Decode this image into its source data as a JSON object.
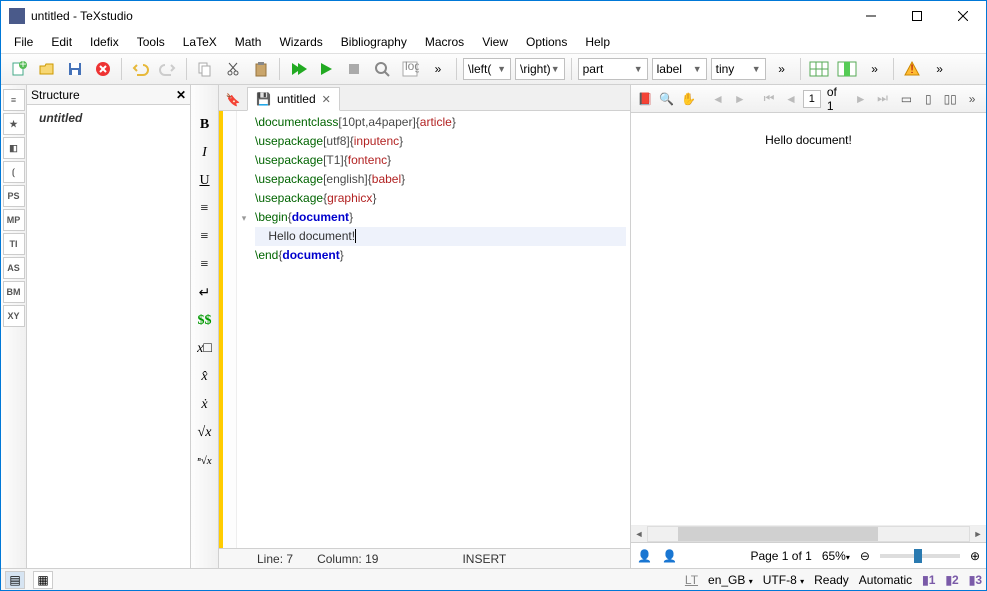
{
  "window": {
    "title": "untitled - TeXstudio"
  },
  "menu": [
    "File",
    "Edit",
    "Idefix",
    "Tools",
    "LaTeX",
    "Math",
    "Wizards",
    "Bibliography",
    "Macros",
    "View",
    "Options",
    "Help"
  ],
  "toolbar_combos": {
    "left_delim": "\\left(",
    "right_delim": "\\right)",
    "section": "part",
    "ref": "label",
    "size": "tiny"
  },
  "structure": {
    "title": "Structure",
    "root": "untitled"
  },
  "left_toolbar_labels": [
    "≡",
    "★",
    "◧",
    "⟮",
    "PS",
    "MP",
    "TI",
    "AS",
    "BM",
    "XY"
  ],
  "mid_toolbar": [
    {
      "glyph": "B",
      "style": "font-weight:bold",
      "name": "bold"
    },
    {
      "glyph": "I",
      "style": "font-style:italic",
      "name": "italic"
    },
    {
      "glyph": "U",
      "style": "text-decoration:underline",
      "name": "underline"
    },
    {
      "glyph": "≡",
      "style": "",
      "name": "align-left"
    },
    {
      "glyph": "≡",
      "style": "",
      "name": "align-center"
    },
    {
      "glyph": "≡",
      "style": "",
      "name": "align-right"
    },
    {
      "glyph": "↵",
      "style": "",
      "name": "newline"
    },
    {
      "glyph": "$$",
      "style": "color:#090;font-weight:bold",
      "name": "math"
    },
    {
      "glyph": "x□",
      "style": "font-style:italic",
      "name": "subscript"
    },
    {
      "glyph": "x̂",
      "style": "font-style:italic",
      "name": "superscript"
    },
    {
      "glyph": "ẋ",
      "style": "font-style:italic",
      "name": "frac"
    },
    {
      "glyph": "√x",
      "style": "font-style:italic",
      "name": "sqrt"
    },
    {
      "glyph": "ⁿ√x",
      "style": "font-style:italic;font-size:11px",
      "name": "nth-root"
    }
  ],
  "tab": {
    "name": "untitled"
  },
  "code": {
    "lines": [
      {
        "type": "cmd",
        "cmd": "\\documentclass",
        "opt": "[10pt,a4paper]",
        "arg": "{article}"
      },
      {
        "type": "cmd",
        "cmd": "\\usepackage",
        "opt": "[utf8]",
        "arg": "{inputenc}"
      },
      {
        "type": "cmd",
        "cmd": "\\usepackage",
        "opt": "[T1]",
        "arg": "{fontenc}"
      },
      {
        "type": "cmd",
        "cmd": "\\usepackage",
        "opt": "[english]",
        "arg": "{babel}"
      },
      {
        "type": "cmd",
        "cmd": "\\usepackage",
        "opt": "",
        "arg": "{graphicx}"
      },
      {
        "type": "env",
        "cmd": "\\begin",
        "env": "document"
      },
      {
        "type": "text",
        "indent": "    ",
        "text": "Hello document!",
        "current": true
      },
      {
        "type": "env",
        "cmd": "\\end",
        "env": "document"
      }
    ]
  },
  "editor_status": {
    "line_label": "Line:",
    "line": "7",
    "col_label": "Column:",
    "col": "19",
    "mode": "INSERT"
  },
  "preview": {
    "page_input": "1",
    "page_of": "of 1",
    "content": "Hello document!",
    "page_label": "Page 1 of 1",
    "zoom": "65%"
  },
  "status": {
    "lang": "en_GB",
    "enc": "UTF-8",
    "ready": "Ready",
    "auto": "Automatic"
  }
}
